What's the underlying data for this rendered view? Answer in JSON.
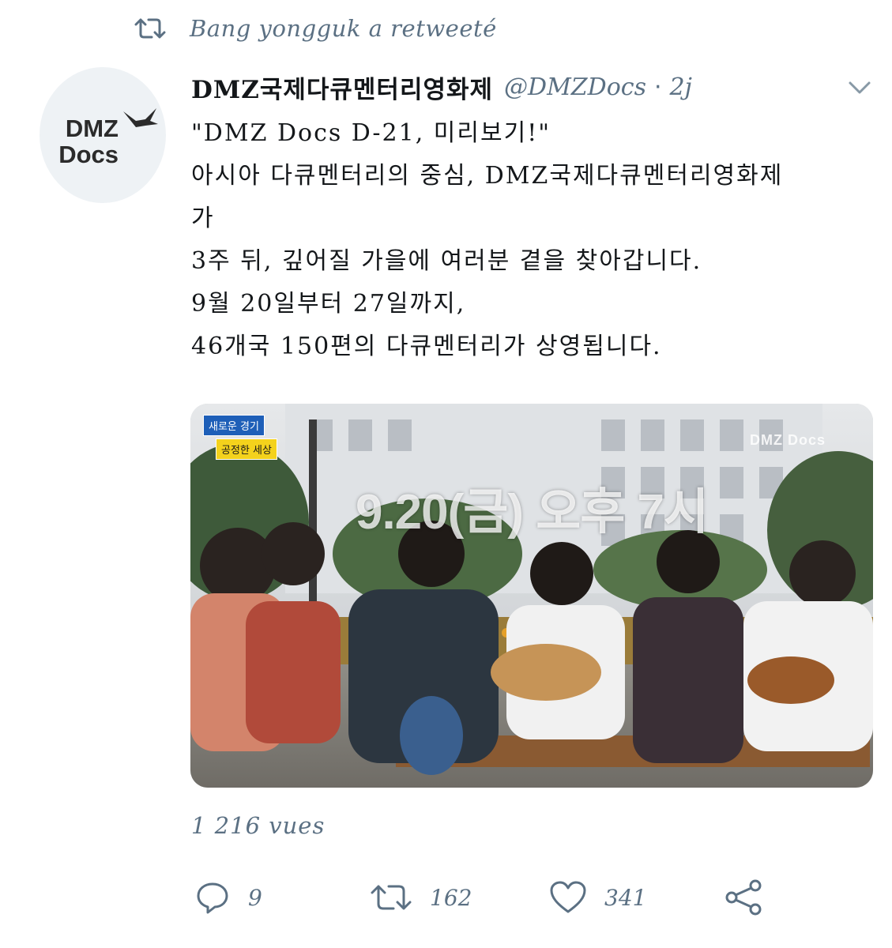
{
  "retweet_banner": {
    "icon": "retweet-icon",
    "text": "Bang yongguk a retweeté"
  },
  "account": {
    "avatar_logo_line1": "DMZ",
    "avatar_logo_line2": "Docs",
    "display_name": "DMZ국제다큐멘터리영화제",
    "handle": "@DMZDocs",
    "separator": "·",
    "time": "2j"
  },
  "tweet": {
    "lines": [
      "\"DMZ Docs D-21, 미리보기!\"",
      "아시아 다큐멘터리의 중심, DMZ국제다큐멘터리영화제",
      "가",
      "3주 뒤, 깊어질 가을에 여러분 곁을 찾아갑니다.",
      "9월 20일부터 27일까지,",
      "46개국 150편의 다큐멘터리가 상영됩니다."
    ]
  },
  "media": {
    "badge_top": "새로운 경기",
    "badge_bottom": "공정한 세상",
    "watermark": "DMZ Docs",
    "overlay_text": "9.20(금) 오후 7시"
  },
  "stats": {
    "views": "1 216 vues"
  },
  "actions": {
    "reply": {
      "icon": "reply-icon",
      "count": "9"
    },
    "retweet": {
      "icon": "retweet-icon",
      "count": "162"
    },
    "like": {
      "icon": "heart-icon",
      "count": "341"
    },
    "share": {
      "icon": "share-icon"
    }
  },
  "colors": {
    "secondary_text": "#5b7083",
    "primary_text": "#14171a",
    "background": "#ffffff"
  }
}
